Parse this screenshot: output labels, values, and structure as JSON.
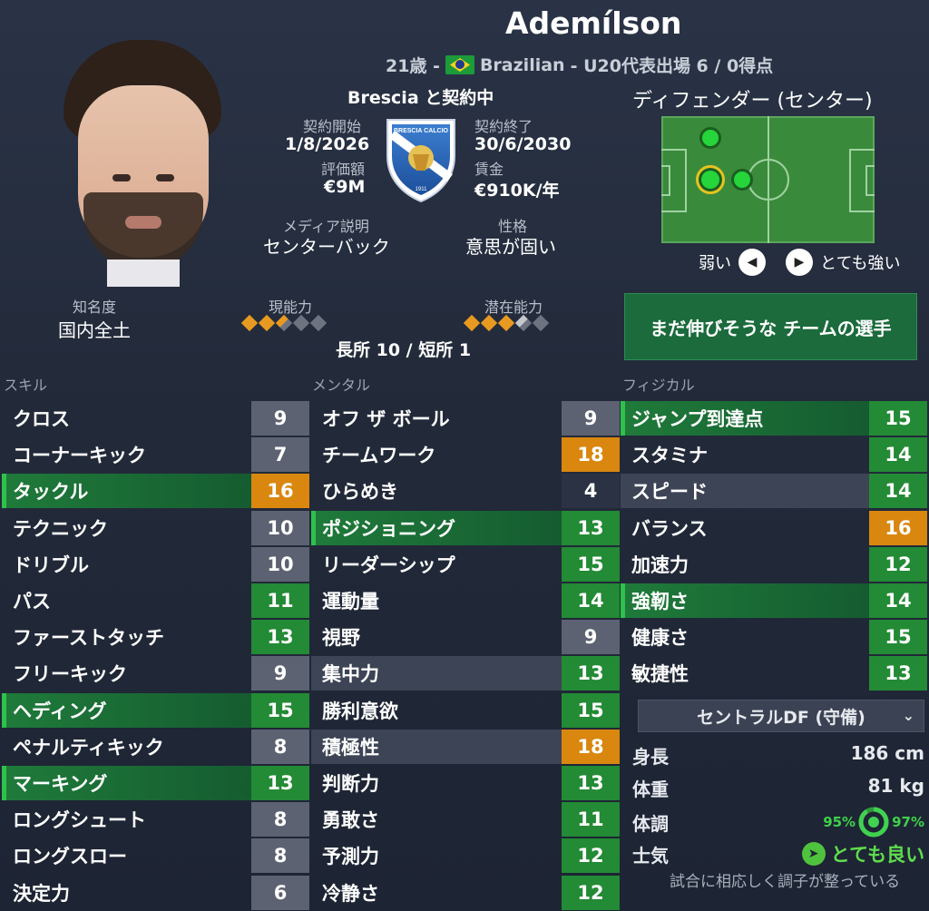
{
  "header": {
    "player_name": "Ademílson",
    "age": "21歳 -",
    "nationality": "Brazilian",
    "intl_caps": "- U20代表出場 6 / 0得点"
  },
  "contract": {
    "club_line": "Brescia と契約中",
    "start_label": "契約開始",
    "start_value": "1/8/2026",
    "end_label": "契約終了",
    "end_value": "30/6/2030",
    "value_label": "評価額",
    "value_value": "€9M",
    "wage_label": "賃金",
    "wage_value": "€910K/年",
    "media_label": "メディア説明",
    "media_value": "センターバック",
    "personality_label": "性格",
    "personality_value": "意思が固い"
  },
  "crest": {
    "text": "BRESCIA CALCIO",
    "year": "1911"
  },
  "position": {
    "title": "ディフェンダー (センター)",
    "weak_label": "弱い",
    "strong_label": "とても強い"
  },
  "reputation": {
    "label": "知名度",
    "value": "国内全土"
  },
  "ability": {
    "current_label": "現能力",
    "potential_label": "潜在能力",
    "current_stars": 2.5,
    "potential_stars": 3.5,
    "traits_line": "長所 10 / 短所 1",
    "potential_box": "まだ伸びそうな チームの選手"
  },
  "sections": {
    "skills": "スキル",
    "mental": "メンタル",
    "physical": "フィジカル"
  },
  "skills": [
    {
      "name": "クロス",
      "value": "9"
    },
    {
      "name": "コーナーキック",
      "value": "7"
    },
    {
      "name": "タックル",
      "value": "16"
    },
    {
      "name": "テクニック",
      "value": "10"
    },
    {
      "name": "ドリブル",
      "value": "10"
    },
    {
      "name": "パス",
      "value": "11"
    },
    {
      "name": "ファーストタッチ",
      "value": "13"
    },
    {
      "name": "フリーキック",
      "value": "9"
    },
    {
      "name": "ヘディング",
      "value": "15"
    },
    {
      "name": "ペナルティキック",
      "value": "8"
    },
    {
      "name": "マーキング",
      "value": "13"
    },
    {
      "name": "ロングシュート",
      "value": "8"
    },
    {
      "name": "ロングスロー",
      "value": "8"
    },
    {
      "name": "決定力",
      "value": "6"
    }
  ],
  "mental": [
    {
      "name": "オフ ザ ボール",
      "value": "9"
    },
    {
      "name": "チームワーク",
      "value": "18"
    },
    {
      "name": "ひらめき",
      "value": "4"
    },
    {
      "name": "ポジショニング",
      "value": "13"
    },
    {
      "name": "リーダーシップ",
      "value": "15"
    },
    {
      "name": "運動量",
      "value": "14"
    },
    {
      "name": "視野",
      "value": "9"
    },
    {
      "name": "集中力",
      "value": "13"
    },
    {
      "name": "勝利意欲",
      "value": "15"
    },
    {
      "name": "積極性",
      "value": "18"
    },
    {
      "name": "判断力",
      "value": "13"
    },
    {
      "name": "勇敢さ",
      "value": "11"
    },
    {
      "name": "予測力",
      "value": "12"
    },
    {
      "name": "冷静さ",
      "value": "12"
    }
  ],
  "physical": [
    {
      "name": "ジャンプ到達点",
      "value": "15"
    },
    {
      "name": "スタミナ",
      "value": "14"
    },
    {
      "name": "スピード",
      "value": "14"
    },
    {
      "name": "バランス",
      "value": "16"
    },
    {
      "name": "加速力",
      "value": "12"
    },
    {
      "name": "強靭さ",
      "value": "14"
    },
    {
      "name": "健康さ",
      "value": "15"
    },
    {
      "name": "敏捷性",
      "value": "13"
    }
  ],
  "role_dropdown": "セントラルDF (守備)",
  "body": {
    "height_label": "身長",
    "height_value": "186 cm",
    "weight_label": "体重",
    "weight_value": "81 kg",
    "condition_label": "体調",
    "condition_left": "95%",
    "condition_right": "97%",
    "morale_label": "士気",
    "morale_value": "とても良い",
    "morale_note": "試合に相応しく調子が整っている"
  },
  "colors": {
    "grey_box": "#5c6272",
    "dark_box": "#2b3243",
    "green_box": "#238a35",
    "orange_box": "#d9870f",
    "highlight": "#1f7a3a"
  }
}
